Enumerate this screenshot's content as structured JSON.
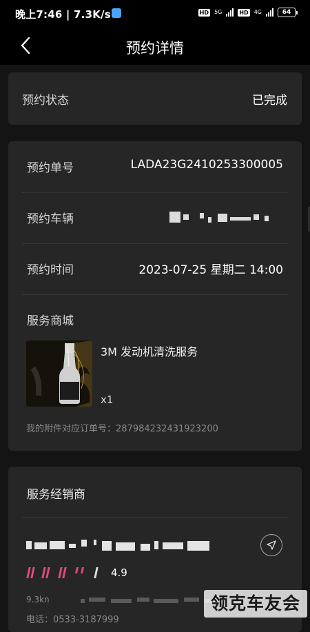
{
  "status_bar": {
    "time": "晚上7:46 | 7.3K/s",
    "network_1": "5G",
    "network_2": "4G",
    "hd_1": "HD",
    "hd_2": "HD",
    "battery": "64"
  },
  "header": {
    "title": "预约详情",
    "back_icon": "chevron-left-icon"
  },
  "status_card": {
    "label": "预约状态",
    "value": "已完成"
  },
  "detail_card": {
    "order_no_label": "预约单号",
    "order_no": "LADA23G2410253300005",
    "vehicle_label": "预约车辆",
    "time_label": "预约时间",
    "time": "2023-07-25 星期二 14:00",
    "mall_label": "服务商城",
    "product_name": "3M 发动机清洗服务",
    "product_qty": "x1",
    "attachment_order": "我的附件对应订单号：287984232431923200"
  },
  "dealer_card": {
    "title": "服务经销商",
    "rating": "4.9",
    "distance": "9.3kn",
    "phone": "电话：0533-3187999",
    "nav_icon": "navigate-arrow-icon"
  },
  "watermark": "领克车友会",
  "colors": {
    "background": "#141414",
    "card": "#262626",
    "rating_accent": "#e04a7d"
  }
}
